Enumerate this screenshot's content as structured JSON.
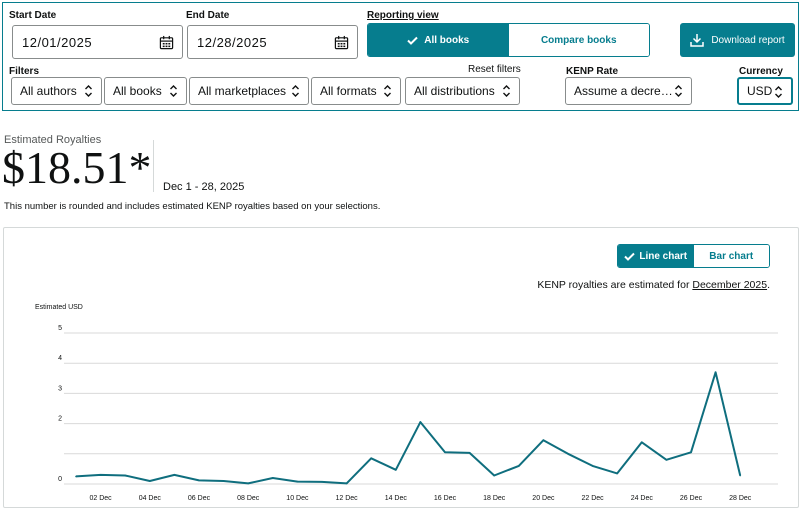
{
  "filters": {
    "start_date_label": "Start Date",
    "start_date_value": "12/01/2025",
    "end_date_label": "End Date",
    "end_date_value": "12/28/2025",
    "reporting_view_label": "Reporting view",
    "view_all_books": "All books",
    "view_compare_books": "Compare books",
    "download_label": "Download report",
    "filters_label": "Filters",
    "reset_filters": "Reset filters",
    "authors": "All authors",
    "books": "All books",
    "marketplaces": "All marketplaces",
    "formats": "All formats",
    "distributions": "All distributions",
    "kenp_rate_label": "KENP Rate",
    "kenp_rate_value": "Assume a decre…",
    "currency_label": "Currency",
    "currency_value": "USD"
  },
  "summary": {
    "label": "Estimated Royalties",
    "value": "$18.51*",
    "date_range": "Dec 1 - 28, 2025",
    "note": "This number is rounded and includes estimated KENP royalties based on your selections."
  },
  "chart_panel": {
    "line_chart_label": "Line chart",
    "bar_chart_label": "Bar chart",
    "kenp_note_prefix": "KENP royalties are estimated for ",
    "kenp_note_link": "December 2025",
    "kenp_note_suffix": "."
  },
  "colors": {
    "accent": "#067d8e",
    "line": "#0f6e7e",
    "grid": "#d9d9d9"
  },
  "chart_data": {
    "type": "line",
    "ylabel": "Estimated USD",
    "ylim": [
      0,
      5
    ],
    "yticks": [
      0,
      1,
      2,
      3,
      4,
      5
    ],
    "ytick_labels": [
      "0",
      "",
      "2",
      "3",
      "4",
      "5"
    ],
    "x": [
      "01 Dec",
      "02 Dec",
      "03 Dec",
      "04 Dec",
      "05 Dec",
      "06 Dec",
      "07 Dec",
      "08 Dec",
      "09 Dec",
      "10 Dec",
      "11 Dec",
      "12 Dec",
      "13 Dec",
      "14 Dec",
      "15 Dec",
      "16 Dec",
      "17 Dec",
      "18 Dec",
      "19 Dec",
      "20 Dec",
      "21 Dec",
      "22 Dec",
      "23 Dec",
      "24 Dec",
      "25 Dec",
      "26 Dec",
      "27 Dec",
      "28 Dec"
    ],
    "xtick_labels": [
      "02 Dec",
      "04 Dec",
      "06 Dec",
      "08 Dec",
      "10 Dec",
      "12 Dec",
      "14 Dec",
      "16 Dec",
      "18 Dec",
      "20 Dec",
      "22 Dec",
      "24 Dec",
      "26 Dec",
      "28 Dec"
    ],
    "series": [
      {
        "values": [
          0.25,
          0.3,
          0.28,
          0.1,
          0.3,
          0.12,
          0.1,
          0.02,
          0.2,
          0.08,
          0.07,
          0.02,
          0.85,
          0.47,
          2.05,
          1.05,
          1.03,
          0.28,
          0.6,
          1.45,
          1.0,
          0.6,
          0.35,
          1.38,
          0.8,
          1.05,
          3.7,
          0.28
        ]
      }
    ]
  }
}
